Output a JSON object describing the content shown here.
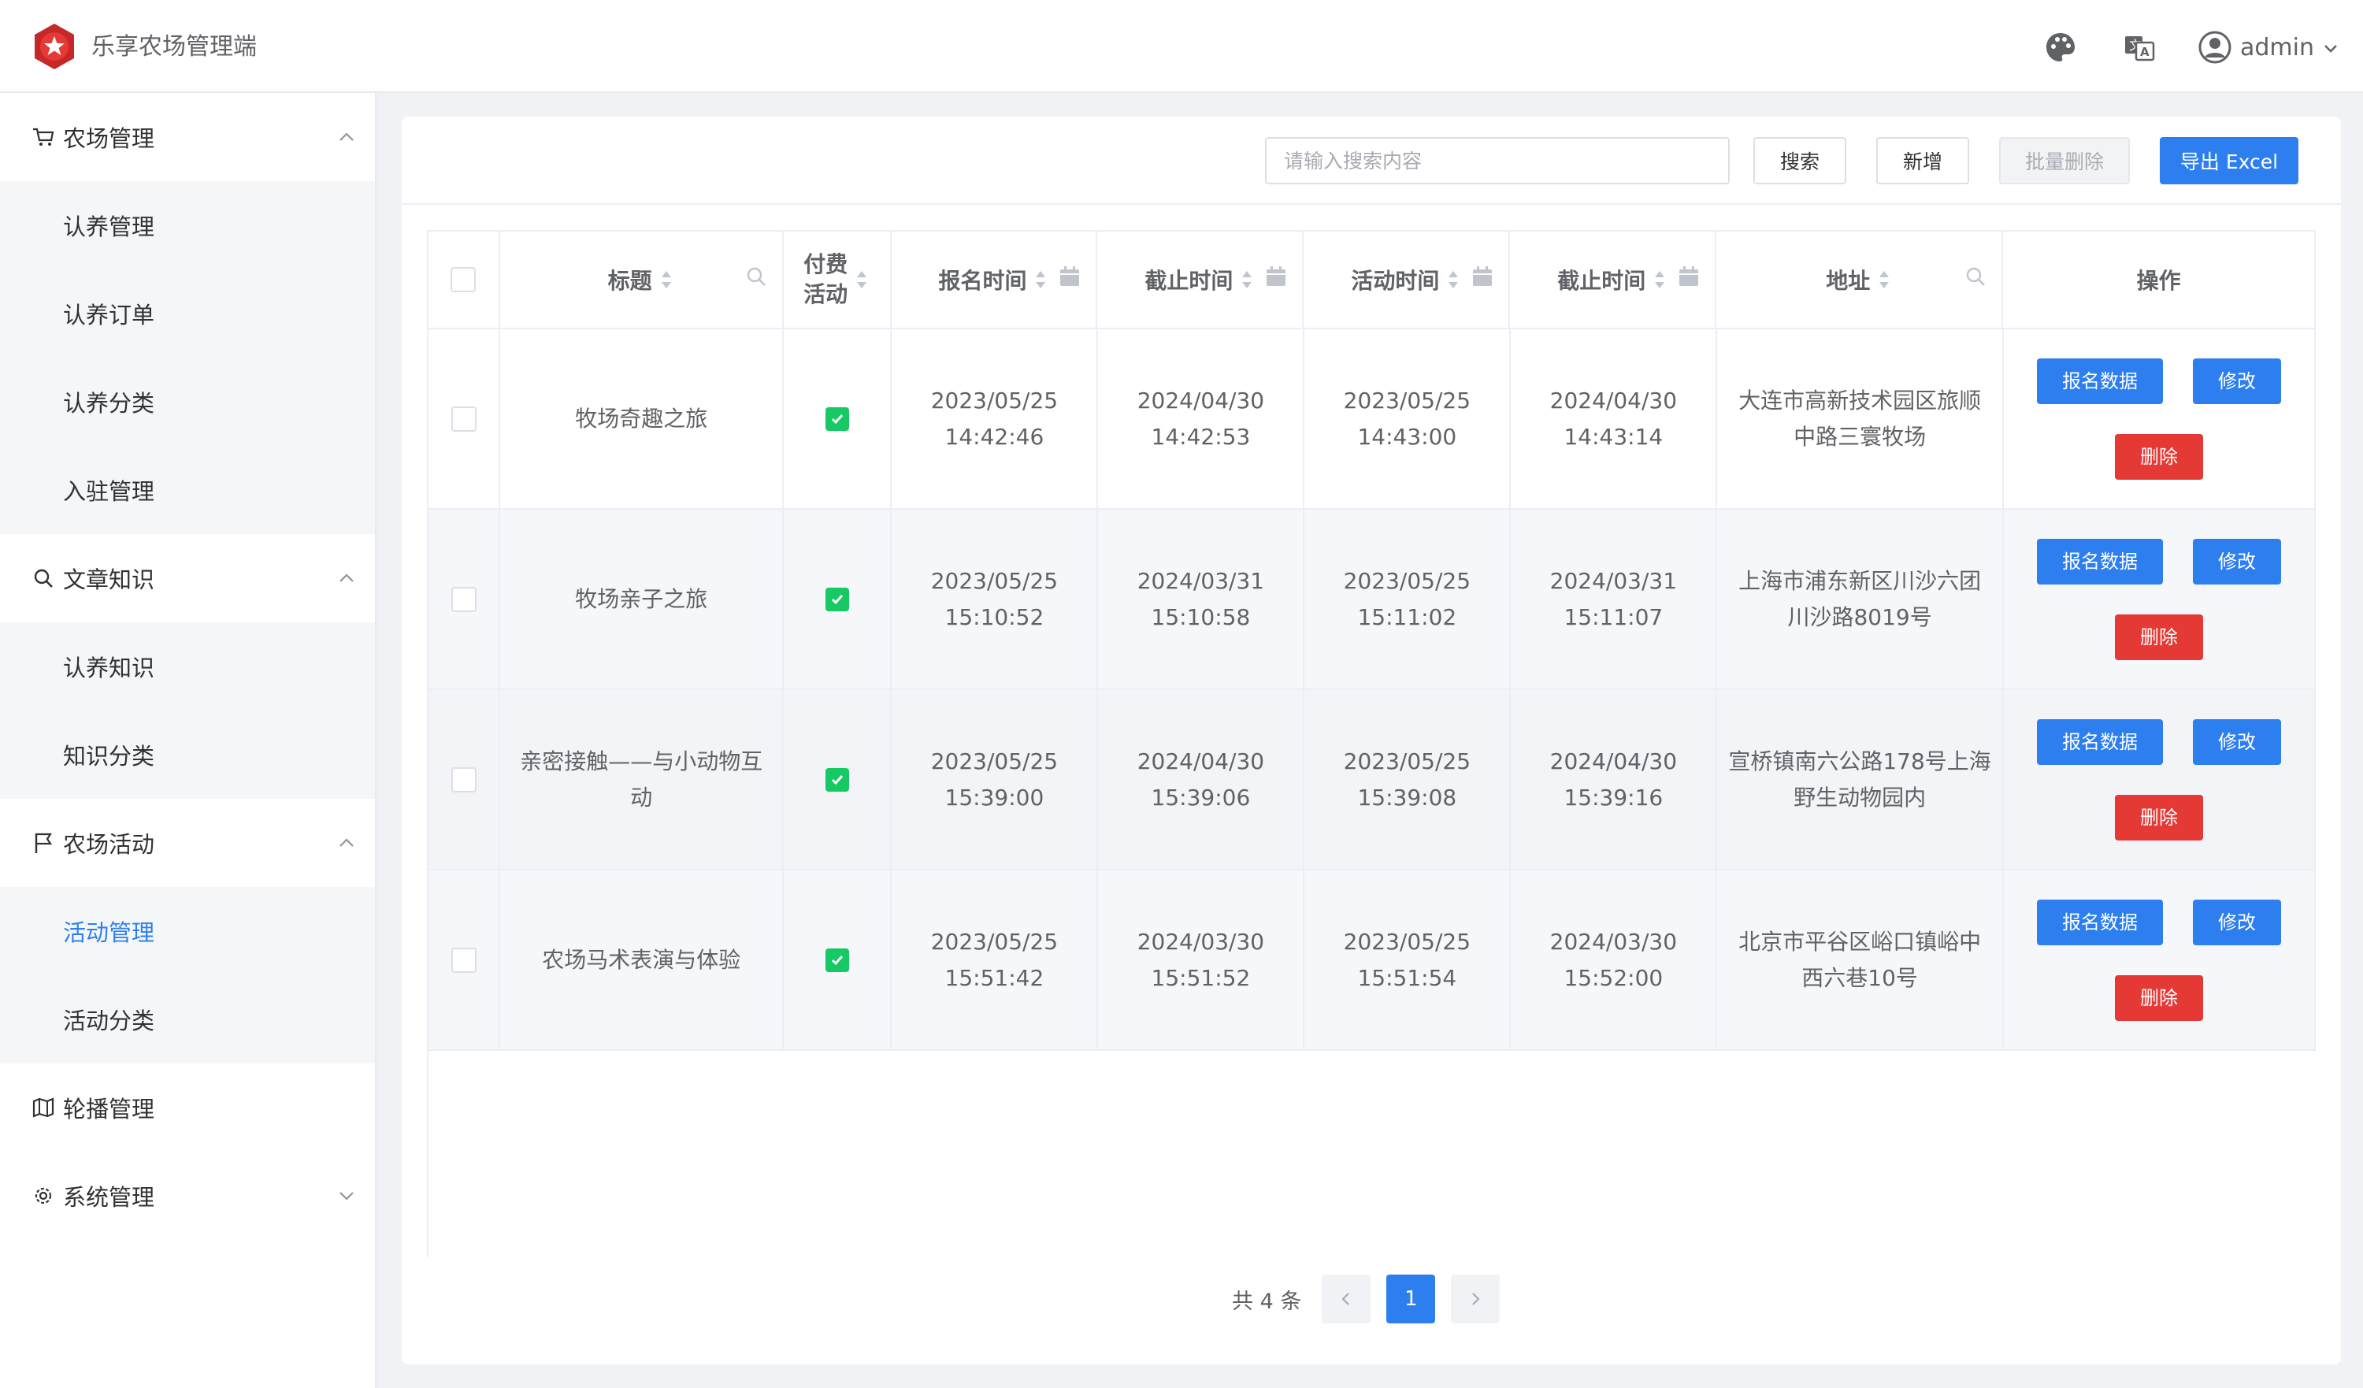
{
  "header": {
    "app_title": "乐享农场管理端",
    "username": "admin",
    "icons": [
      "logo-icon",
      "palette-icon",
      "translate-icon",
      "user-avatar-icon",
      "chevron-down-icon"
    ]
  },
  "sidebar": {
    "groups": [
      {
        "title": "农场管理",
        "icon": "cart-icon",
        "expanded": true,
        "items": [
          "认养管理",
          "认养订单",
          "认养分类",
          "入驻管理"
        ]
      },
      {
        "title": "文章知识",
        "icon": "search-icon",
        "expanded": true,
        "items": [
          "认养知识",
          "知识分类"
        ]
      },
      {
        "title": "农场活动",
        "icon": "flag-icon",
        "expanded": true,
        "items": [
          "活动管理",
          "活动分类"
        ],
        "active_item": "活动管理"
      },
      {
        "title": "轮播管理",
        "icon": "map-icon",
        "expanded": false,
        "items": []
      },
      {
        "title": "系统管理",
        "icon": "gear-icon",
        "expanded": false,
        "items": []
      }
    ]
  },
  "toolbar": {
    "search_placeholder": "请输入搜索内容",
    "search_label": "搜索",
    "add_label": "新增",
    "batch_delete_label": "批量删除",
    "export_label": "导出 Excel"
  },
  "table": {
    "headers": {
      "title": "标题",
      "paid_line1": "付费",
      "paid_line2": "活动",
      "signup_time": "报名时间",
      "signup_deadline": "截止时间",
      "activity_time": "活动时间",
      "activity_deadline": "截止时间",
      "address": "地址",
      "actions": "操作"
    },
    "action_labels": {
      "signup_data": "报名数据",
      "edit": "修改",
      "delete": "删除"
    },
    "rows": [
      {
        "title": "牧场奇趣之旅",
        "paid": true,
        "signup_date": "2023/05/25",
        "signup_clock": "14:42:46",
        "deadline1_date": "2024/04/30",
        "deadline1_clock": "14:42:53",
        "activity_date": "2023/05/25",
        "activity_clock": "14:43:00",
        "deadline2_date": "2024/04/30",
        "deadline2_clock": "14:43:14",
        "address": "大连市高新技术园区旅顺中路三寰牧场"
      },
      {
        "title": "牧场亲子之旅",
        "paid": true,
        "signup_date": "2023/05/25",
        "signup_clock": "15:10:52",
        "deadline1_date": "2024/03/31",
        "deadline1_clock": "15:10:58",
        "activity_date": "2023/05/25",
        "activity_clock": "15:11:02",
        "deadline2_date": "2024/03/31",
        "deadline2_clock": "15:11:07",
        "address": "上海市浦东新区川沙六团川沙路8019号"
      },
      {
        "title": "亲密接触——与小动物互动",
        "paid": true,
        "signup_date": "2023/05/25",
        "signup_clock": "15:39:00",
        "deadline1_date": "2024/04/30",
        "deadline1_clock": "15:39:06",
        "activity_date": "2023/05/25",
        "activity_clock": "15:39:08",
        "deadline2_date": "2024/04/30",
        "deadline2_clock": "15:39:16",
        "address": "宣桥镇南六公路178号上海野生动物园内"
      },
      {
        "title": "农场马术表演与体验",
        "paid": true,
        "signup_date": "2023/05/25",
        "signup_clock": "15:51:42",
        "deadline1_date": "2024/03/30",
        "deadline1_clock": "15:51:52",
        "activity_date": "2023/05/25",
        "activity_clock": "15:51:54",
        "deadline2_date": "2024/03/30",
        "deadline2_clock": "15:52:00",
        "address": "北京市平谷区峪口镇峪中西六巷10号"
      }
    ]
  },
  "pagination": {
    "total_text": "共 4 条",
    "current_page": "1"
  },
  "colors": {
    "primary": "#2d7ff0",
    "danger": "#e53935",
    "success": "#17c964",
    "active_menu": "#2d7ff0"
  }
}
